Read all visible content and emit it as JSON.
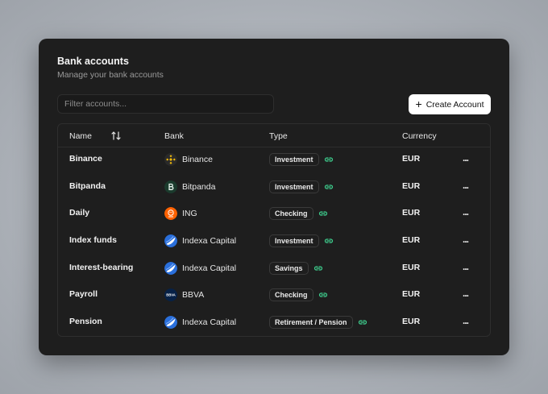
{
  "header": {
    "title": "Bank accounts",
    "subtitle": "Manage your bank accounts"
  },
  "filter": {
    "placeholder": "Filter accounts...",
    "value": ""
  },
  "create_button": {
    "label": "Create Account",
    "icon": "plus-icon"
  },
  "table": {
    "columns": [
      "Name",
      "Bank",
      "Type",
      "Currency"
    ],
    "sort_icon": "sort-arrows-icon",
    "rows": [
      {
        "name": "Binance",
        "bank": "Binance",
        "type": "Investment",
        "currency": "EUR",
        "more": "..."
      },
      {
        "name": "Bitpanda",
        "bank": "Bitpanda",
        "type": "Investment",
        "currency": "EUR",
        "more": "..."
      },
      {
        "name": "Daily",
        "bank": "ING",
        "type": "Checking",
        "currency": "EUR",
        "more": "..."
      },
      {
        "name": "Index funds",
        "bank": "Indexa Capital",
        "type": "Investment",
        "currency": "EUR",
        "more": "..."
      },
      {
        "name": "Interest-bearing",
        "bank": "Indexa Capital",
        "type": "Savings",
        "currency": "EUR",
        "more": "..."
      },
      {
        "name": "Payroll",
        "bank": "BBVA",
        "type": "Checking",
        "currency": "EUR",
        "more": "..."
      },
      {
        "name": "Pension",
        "bank": "Indexa Capital",
        "type": "Retirement / Pension",
        "currency": "EUR",
        "more": "..."
      }
    ]
  },
  "colors": {
    "card_bg": "#1e1e1e",
    "link_icon": "#3ecf8e",
    "binance": "#f0b90b",
    "bitpanda": "#1b3b2d",
    "ing": "#ff6200",
    "indexa": "#2a6fdb",
    "bbva": "#072146"
  },
  "logo_text": {
    "bbva": "BBVA"
  }
}
